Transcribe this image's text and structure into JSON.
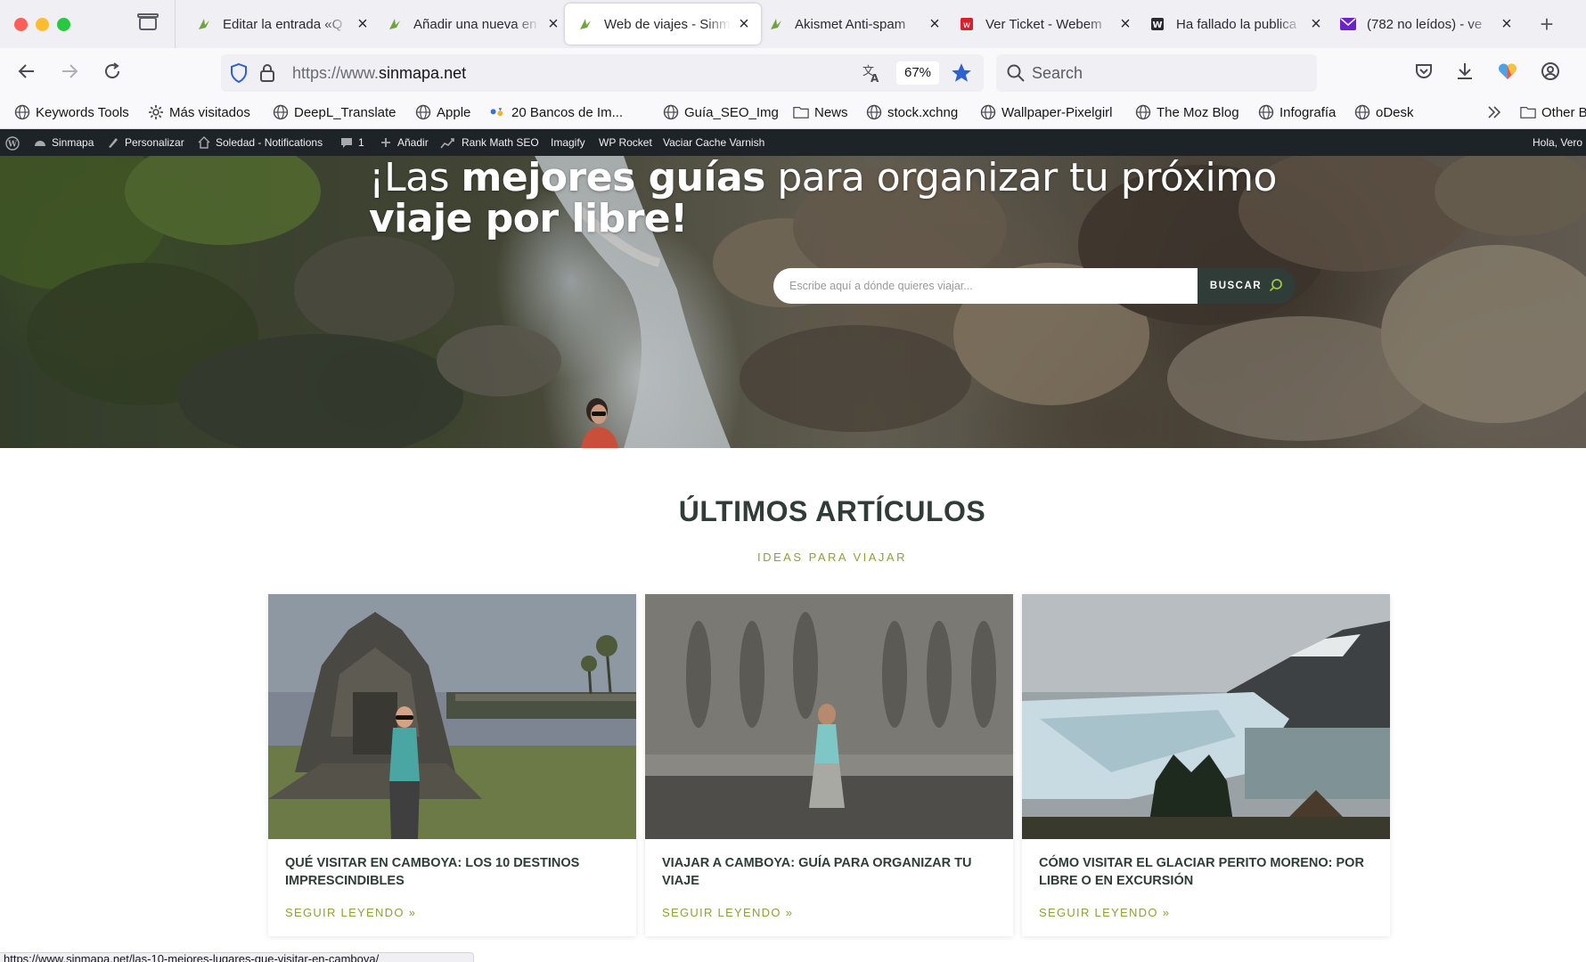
{
  "browser": {
    "tabs": [
      {
        "title": "Editar la entrada «Q",
        "active": false
      },
      {
        "title": "Añadir una nueva en",
        "active": false
      },
      {
        "title": "Web de viajes - Sinm",
        "active": true
      },
      {
        "title": "Akismet Anti-spam",
        "active": false
      },
      {
        "title": "Ver Ticket - Webem",
        "active": false
      },
      {
        "title": "Ha fallado la publica",
        "active": false
      },
      {
        "title": "(782 no leídos) - ve",
        "active": false
      }
    ],
    "url_prefix": "https://www.",
    "url_domain": "sinmapa.net",
    "zoom": "67%",
    "search_placeholder": "Search",
    "bookmarks": [
      "Keywords Tools",
      "Más visitados",
      "DeepL_Translate",
      "Apple",
      "20 Bancos de Im...",
      "Guía_SEO_Img",
      "News",
      "stock.xchng",
      "Wallpaper-Pixelgirl",
      "The Moz Blog",
      "Infografía",
      "oDesk"
    ],
    "bookmarks_other": "Other B",
    "status_url": "https://www.sinmapa.net/las-10-mejores-lugares-que-visitar-en-camboya/"
  },
  "adminbar": {
    "site": "Sinmapa",
    "customize": "Personalizar",
    "notifications": "Soledad - Notifications",
    "comments": "1",
    "add": "Añadir",
    "rankmath": "Rank Math SEO",
    "imagify": "Imagify",
    "wprocket": "WP Rocket",
    "varnish": "Vaciar Cache Varnish",
    "greeting": "Hola, Vero"
  },
  "hero": {
    "title_part1": "¡Las ",
    "title_part2": "mejores guías",
    "title_part3": " para organizar tu próximo",
    "title_part4": "viaje por libre!",
    "search_placeholder": "Escribe aquí a dónde quieres viajar...",
    "search_button": "BUSCAR"
  },
  "section": {
    "title": "ÚLTIMOS ARTÍCULOS",
    "subtitle": "IDEAS PARA VIAJAR"
  },
  "cards": [
    {
      "title": "QUÉ VISITAR EN CAMBOYA: LOS 10 DESTINOS IMPRESCINDIBLES",
      "more": "SEGUIR LEYENDO »"
    },
    {
      "title": "VIAJAR A CAMBOYA: GUÍA PARA ORGANIZAR TU VIAJE",
      "more": "SEGUIR LEYENDO »"
    },
    {
      "title": "CÓMO VISITAR EL GLACIAR PERITO MORENO: POR LIBRE O EN EXCURSIÓN",
      "more": "SEGUIR LEYENDO »"
    }
  ],
  "colors": {
    "accent_green": "#8aa33d",
    "dark_teal": "#2f3c38",
    "admin_bar": "#1d2327"
  }
}
